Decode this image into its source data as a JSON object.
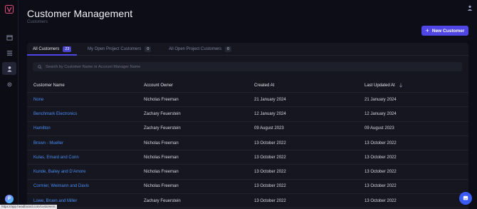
{
  "header": {
    "title": "Customer Management",
    "breadcrumb": "Customers",
    "new_button_label": "New Customer"
  },
  "sidebar": {
    "items": [
      {
        "name": "calendar-icon",
        "active": false
      },
      {
        "name": "list-icon",
        "active": false
      },
      {
        "name": "person-icon",
        "active": true
      },
      {
        "name": "gear-icon",
        "active": false
      }
    ],
    "avatar_initial": "P"
  },
  "tabs": [
    {
      "label": "All Customers",
      "count": "23",
      "active": true
    },
    {
      "label": "My Open Project Customers",
      "count": "0",
      "active": false
    },
    {
      "label": "All Open Project Customers",
      "count": "0",
      "active": false
    }
  ],
  "search": {
    "placeholder": "Search by Customer Name or Account Manager Name"
  },
  "table": {
    "columns": [
      "Customer Name",
      "Account Owner",
      "Created At",
      "Last Updated At"
    ],
    "rows": [
      [
        "None",
        "Nicholas Freeman",
        "21 January 2024",
        "21 January 2024"
      ],
      [
        "Benchmark Electronics",
        "Zachary Feuerstein",
        "12 January 2024",
        "12 January 2024"
      ],
      [
        "Hamilton",
        "Zachary Feuerstein",
        "09 August 2023",
        "09 August 2023"
      ],
      [
        "Brown - Mueller",
        "Nicholas Freeman",
        "13 October 2022",
        "13 October 2022"
      ],
      [
        "Kulas, Emard and Conn",
        "Nicholas Freeman",
        "13 October 2022",
        "13 October 2022"
      ],
      [
        "Kunde, Bailey and D'Amore",
        "Nicholas Freeman",
        "13 October 2022",
        "13 October 2022"
      ],
      [
        "Cormier, Weimann and Davis",
        "Nicholas Freeman",
        "13 October 2022",
        "13 October 2022"
      ],
      [
        "Lowe, Bruen and Miller",
        "Zachary Feuerstein",
        "13 October 2022",
        "13 October 2022"
      ]
    ]
  },
  "status_bar_url": "https://app.headboard.com/customers",
  "colors": {
    "accent": "#5046e5",
    "link": "#4a8cf5",
    "background": "#0c0d16",
    "panel": "#15161f"
  }
}
